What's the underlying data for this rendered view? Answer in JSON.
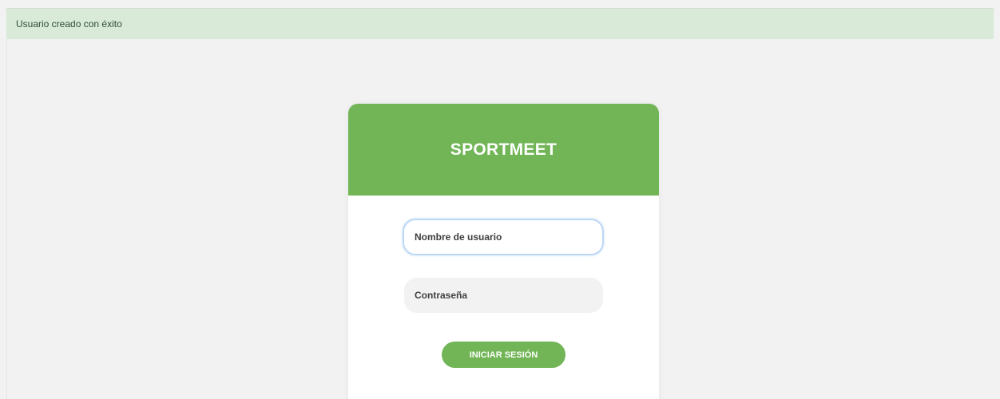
{
  "alert": {
    "message": "Usuario creado con éxito",
    "background_color": "#d9ead9"
  },
  "login_card": {
    "brand": "SPORTMEET",
    "brand_color": "#71b556",
    "username": {
      "placeholder": "Nombre de usuario",
      "value": ""
    },
    "password": {
      "placeholder": "Contraseña",
      "value": ""
    },
    "submit_label": "INICIAR SESIÓN"
  }
}
